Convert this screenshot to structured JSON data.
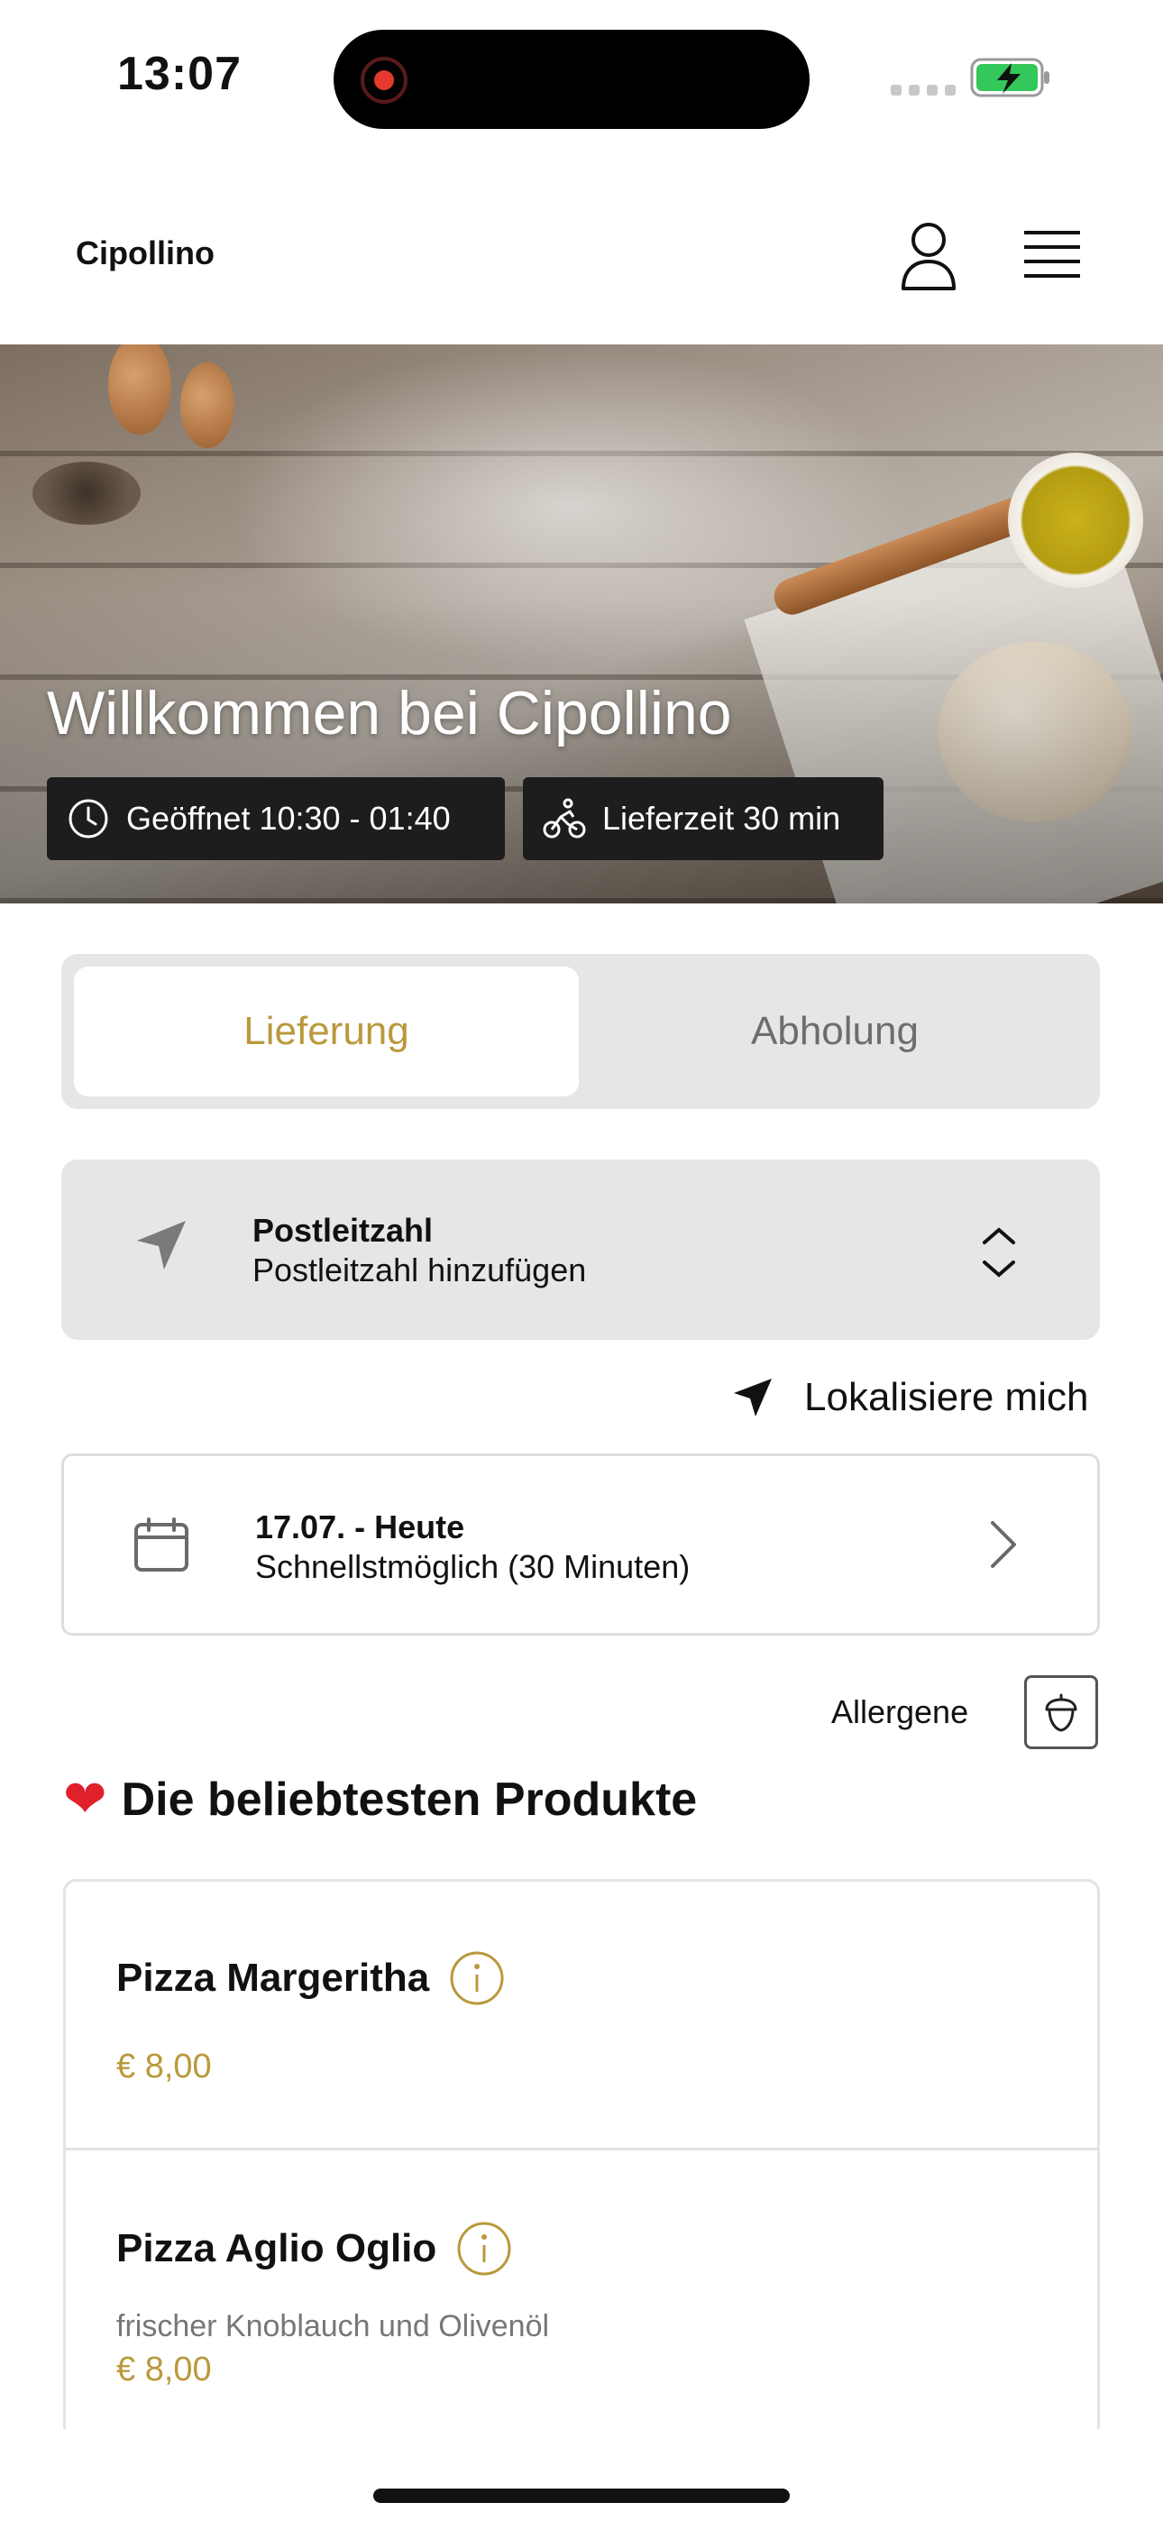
{
  "status_bar": {
    "time": "13:07"
  },
  "header": {
    "brand": "Cipollino"
  },
  "hero": {
    "title": "Willkommen bei Cipollino",
    "open_hours": "Geöffnet 10:30 - 01:40",
    "delivery_time": "Lieferzeit 30 min"
  },
  "order_mode": {
    "options": [
      {
        "label": "Lieferung",
        "active": true
      },
      {
        "label": "Abholung",
        "active": false
      }
    ],
    "active_color": "#b9993c"
  },
  "postal": {
    "label": "Postleitzahl",
    "value": "Postleitzahl hinzufügen"
  },
  "locate": {
    "label": "Lokalisiere mich"
  },
  "schedule": {
    "date": "17.07. - Heute",
    "time": "Schnellstmöglich (30 Minuten)"
  },
  "allergens": {
    "label": "Allergene"
  },
  "popular": {
    "title": "Die beliebtesten Produkte",
    "icon": "heart-icon",
    "items": [
      {
        "name": "Pizza Margeritha",
        "description": "",
        "price": "€ 8,00"
      },
      {
        "name": "Pizza Aglio Oglio",
        "description": "frischer Knoblauch und Olivenöl",
        "price": "€ 8,00"
      }
    ]
  }
}
